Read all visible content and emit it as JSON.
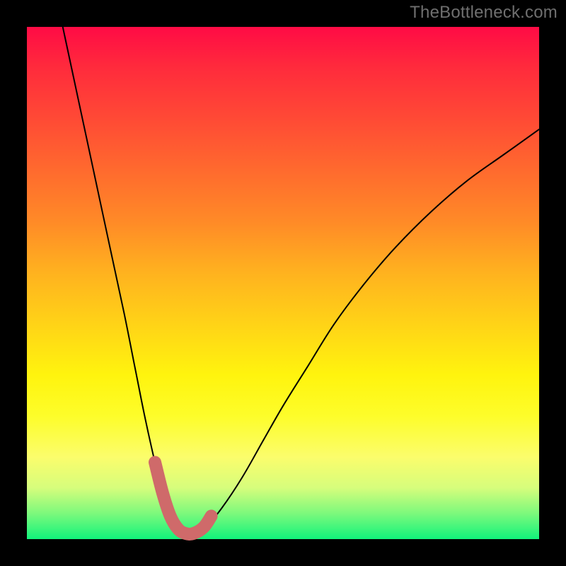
{
  "watermark": "TheBottleneck.com",
  "chart_data": {
    "type": "line",
    "title": "",
    "xlabel": "",
    "ylabel": "",
    "xlim": [
      0,
      100
    ],
    "ylim": [
      0,
      100
    ],
    "grid": false,
    "legend": false,
    "series": [
      {
        "name": "curve",
        "color": "#000000",
        "x": [
          7,
          10,
          13,
          16,
          19,
          21,
          23,
          25,
          26.5,
          28,
          29.5,
          31,
          32.5,
          35,
          38,
          42,
          46,
          50,
          55,
          60,
          66,
          72,
          79,
          86,
          93,
          100
        ],
        "y": [
          100,
          86,
          72,
          58,
          44,
          34,
          24,
          15,
          9,
          4.5,
          2,
          1.1,
          1.1,
          2.5,
          6,
          12,
          19,
          26,
          34,
          42,
          50,
          57,
          64,
          70,
          75,
          80
        ]
      },
      {
        "name": "highlight",
        "color": "#d06464",
        "x": [
          25,
          26.5,
          28,
          29.5,
          31,
          32.5,
          34.5,
          36
        ],
        "y": [
          15,
          9,
          4.5,
          2,
          1.1,
          1.1,
          2.3,
          4.5
        ]
      }
    ],
    "background_gradient": {
      "direction": "vertical",
      "stops": [
        {
          "pos": 0.0,
          "color": "#ff0b45"
        },
        {
          "pos": 0.5,
          "color": "#ffb21f"
        },
        {
          "pos": 0.75,
          "color": "#fff40e"
        },
        {
          "pos": 1.0,
          "color": "#11f37b"
        }
      ]
    }
  }
}
